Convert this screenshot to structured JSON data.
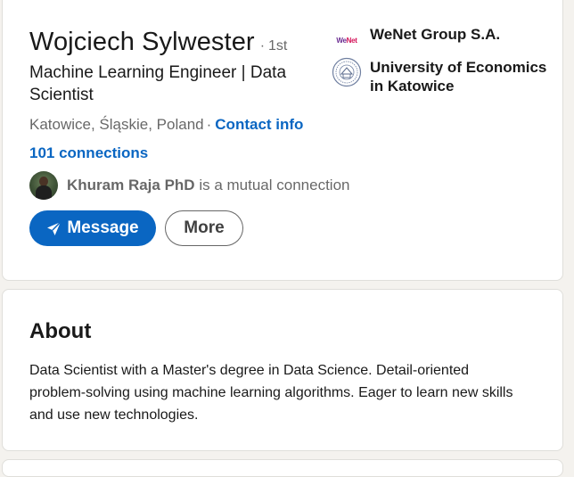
{
  "profile": {
    "name": "Wojciech Sylwester",
    "degree": "1st",
    "headline": "Machine Learning Engineer | Data Scientist",
    "location": "Katowice, Śląskie, Poland",
    "contact_info_label": "Contact info",
    "connections_label": "101 connections",
    "mutual_connection": {
      "name": "Khuram Raja PhD",
      "suffix": "is a mutual connection"
    },
    "buttons": {
      "message_label": "Message",
      "more_label": "More"
    },
    "experience": [
      {
        "name": "WeNet Group S.A.",
        "logo_text": "WeNet",
        "icon": "wenet-logo"
      },
      {
        "name": "University of Economics in Katowice",
        "icon": "university-seal-logo"
      }
    ]
  },
  "about": {
    "title": "About",
    "text": "Data Scientist with a Master's degree in Data Science. Detail-oriented problem-solving using machine learning algorithms. Eager to learn new skills and use new technologies."
  },
  "colors": {
    "accent": "#0a66c2",
    "page_background": "#f4f2ee",
    "card_background": "#ffffff"
  }
}
